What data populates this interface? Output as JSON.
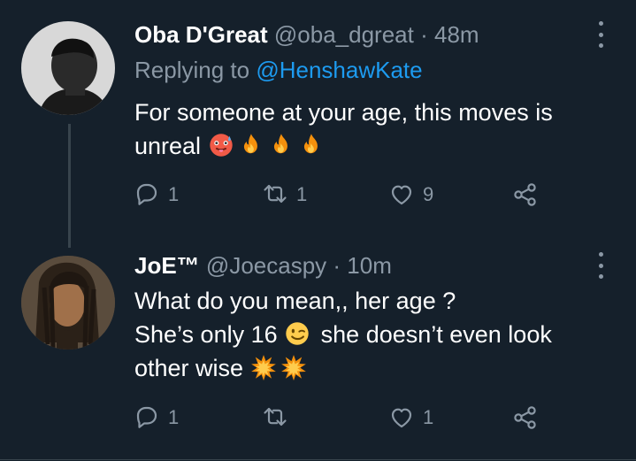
{
  "tweets": [
    {
      "name": "Oba D'Great",
      "handle": "@oba_dgreat",
      "separator": "·",
      "time": "48m",
      "replying_prefix": "Replying to",
      "replying_to": "@HenshawKate",
      "text_line1": "For someone at your age, this moves is",
      "text_line2": "unreal",
      "emojis": [
        "hot-face-emoji",
        "fire-emoji",
        "fire-emoji",
        "fire-emoji"
      ],
      "replies": "1",
      "retweets": "1",
      "likes": "9"
    },
    {
      "name": "JoE™",
      "handle": "@Joecaspy",
      "separator": "·",
      "time": "10m",
      "text_line1": "What do you mean,, her age ?",
      "text_line2_a": "She’s only 16",
      "text_line2_b": "she doesn’t even look",
      "text_line3": "other wise",
      "emojis": [
        "winking-face-emoji",
        "collision-emoji",
        "collision-emoji"
      ],
      "replies": "1",
      "retweets": "",
      "likes": "1"
    }
  ],
  "colors": {
    "background": "#15202b",
    "secondary_text": "#8b98a5",
    "link": "#1d9bf0",
    "divider": "#38444d"
  }
}
